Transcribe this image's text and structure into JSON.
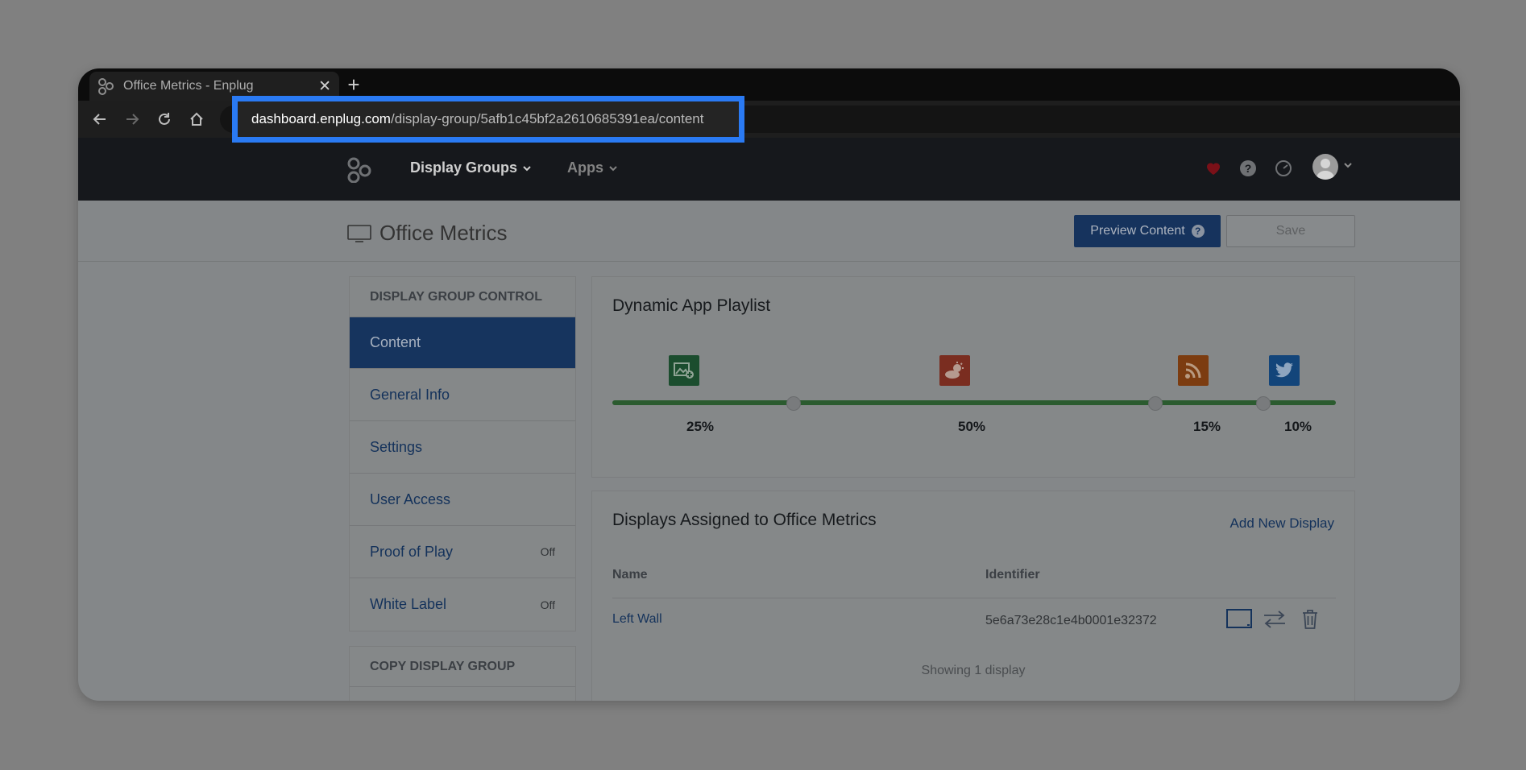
{
  "browser": {
    "tab_title": "Office Metrics - Enplug",
    "url_host": "dashboard.enplug.com",
    "url_path": "/display-group/5afb1c45bf2a2610685391ea/content"
  },
  "header": {
    "nav": [
      {
        "label": "Display Groups"
      },
      {
        "label": "Apps"
      }
    ]
  },
  "page": {
    "title": "Office Metrics",
    "preview_button": "Preview Content",
    "preview_badge": "?",
    "save_button": "Save"
  },
  "sidebar": {
    "control_heading": "DISPLAY GROUP CONTROL",
    "items": [
      {
        "label": "Content",
        "active": true,
        "badge": ""
      },
      {
        "label": "General Info",
        "badge": ""
      },
      {
        "label": "Settings",
        "badge": ""
      },
      {
        "label": "User Access",
        "badge": ""
      },
      {
        "label": "Proof of Play",
        "badge": "Off"
      },
      {
        "label": "White Label",
        "badge": "Off"
      }
    ],
    "copy_heading": "COPY DISPLAY GROUP"
  },
  "playlist": {
    "title": "Dynamic App Playlist",
    "apps": [
      {
        "icon": "gallery-icon",
        "color": "#1b4d2e",
        "percent": "25%"
      },
      {
        "icon": "weather-icon",
        "color": "#7a2d20",
        "percent": "50%"
      },
      {
        "icon": "rss-icon",
        "color": "#7c3c10",
        "percent": "15%"
      },
      {
        "icon": "twitter-icon",
        "color": "#13457a",
        "percent": "10%"
      }
    ]
  },
  "displays": {
    "title": "Displays Assigned to Office Metrics",
    "add_link": "Add New Display",
    "columns": {
      "name": "Name",
      "identifier": "Identifier"
    },
    "rows": [
      {
        "name": "Left Wall",
        "identifier": "5e6a73e28c1e4b0001e32372"
      }
    ],
    "footer": "Showing 1 display"
  },
  "colors": {
    "highlight": "#2a7af3",
    "primary": "#16345e",
    "slider": "#2b5b2f",
    "heart": "#7a1018"
  }
}
